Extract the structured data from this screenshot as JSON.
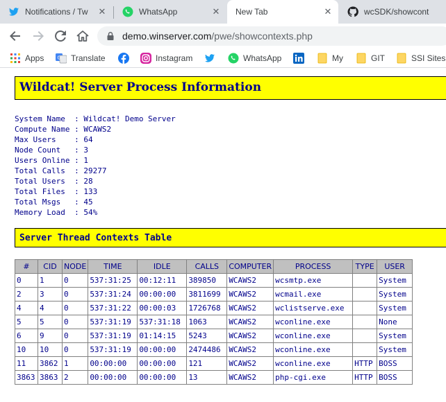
{
  "browser": {
    "tabs": [
      {
        "title": "Notifications / Tw",
        "icon": "twitter-icon",
        "active": false
      },
      {
        "title": "WhatsApp",
        "icon": "whatsapp-icon",
        "active": false
      },
      {
        "title": "New Tab",
        "icon": "",
        "active": true
      },
      {
        "title": "wcSDK/showcont",
        "icon": "github-icon",
        "active": false
      }
    ],
    "address": {
      "host": "demo.winserver.com",
      "path": "/pwe/showcontexts.php"
    },
    "bookmarks": [
      {
        "label": "Apps",
        "icon": "apps-grid-icon"
      },
      {
        "label": "Translate",
        "icon": "google-translate-icon"
      },
      {
        "label": "",
        "icon": "facebook-icon"
      },
      {
        "label": "Instagram",
        "icon": "instagram-icon"
      },
      {
        "label": "",
        "icon": "twitter-icon"
      },
      {
        "label": "WhatsApp",
        "icon": "whatsapp-icon"
      },
      {
        "label": "",
        "icon": "linkedin-icon"
      },
      {
        "label": "My",
        "icon": "folder-icon"
      },
      {
        "label": "GIT",
        "icon": "folder-icon"
      },
      {
        "label": "SSI Sites",
        "icon": "folder-icon"
      }
    ]
  },
  "page": {
    "title": "Wildcat! Server Process Information",
    "info": [
      {
        "label": "System Name  ",
        "value": "Wildcat! Demo Server"
      },
      {
        "label": "Compute Name ",
        "value": "WCAWS2"
      },
      {
        "label": "Max Users    ",
        "value": "64"
      },
      {
        "label": "Node Count   ",
        "value": "3"
      },
      {
        "label": "Users Online ",
        "value": "1"
      },
      {
        "label": "Total Calls  ",
        "value": "29277"
      },
      {
        "label": "Total Users  ",
        "value": "28"
      },
      {
        "label": "Total Files  ",
        "value": "133"
      },
      {
        "label": "Total Msgs   ",
        "value": "45"
      },
      {
        "label": "Memory Load  ",
        "value": "54%"
      }
    ],
    "table_title": "Server Thread Contexts Table",
    "table": {
      "headers": [
        "#",
        "CID",
        "NODE",
        "TIME",
        "IDLE",
        "CALLS",
        "COMPUTER",
        "PROCESS",
        "TYPE",
        "USER"
      ],
      "rows": [
        [
          "0",
          "1",
          "0",
          "537:31:25",
          "00:12:11",
          "389850",
          "WCAWS2",
          "wcsmtp.exe",
          "",
          "System"
        ],
        [
          "2",
          "3",
          "0",
          "537:31:24",
          "00:00:00",
          "3811699",
          "WCAWS2",
          "wcmail.exe",
          "",
          "System"
        ],
        [
          "4",
          "4",
          "0",
          "537:31:22",
          "00:00:03",
          "1726768",
          "WCAWS2",
          "wclistserve.exe",
          "",
          "System"
        ],
        [
          "5",
          "5",
          "0",
          "537:31:19",
          "537:31:18",
          "1063",
          "WCAWS2",
          "wconline.exe",
          "",
          "None"
        ],
        [
          "6",
          "9",
          "0",
          "537:31:19",
          "01:14:15",
          "5243",
          "WCAWS2",
          "wconline.exe",
          "",
          "System"
        ],
        [
          "10",
          "10",
          "0",
          "537:31:19",
          "00:00:00",
          "2474486",
          "WCAWS2",
          "wconline.exe",
          "",
          "System"
        ],
        [
          "11",
          "3862",
          "1",
          "00:00:00",
          "00:00:00",
          "121",
          "WCAWS2",
          "wconline.exe",
          "HTTP",
          "BOSS"
        ],
        [
          "3863",
          "3863",
          "2",
          "00:00:00",
          "00:00:00",
          "13",
          "WCAWS2",
          "php-cgi.exe",
          "HTTP",
          "BOSS"
        ]
      ]
    }
  },
  "colors": {
    "banner_bg": "#ffff00",
    "text": "#00008b",
    "header_bg": "#c0c0c0"
  }
}
